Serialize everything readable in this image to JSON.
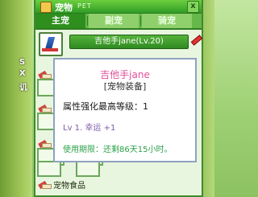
{
  "window": {
    "title": "宠物",
    "title_sub": "PET",
    "close_label": "x"
  },
  "tabs": [
    {
      "label": "主宠"
    },
    {
      "label": "副宠"
    },
    {
      "label": "骑宠"
    }
  ],
  "pet": {
    "name_level": "吉他手jane(Lv.20)"
  },
  "side_labels": [
    "S",
    "X",
    "讥",
    "匙"
  ],
  "bottom_label": "宠物食品",
  "tooltip": {
    "title": "吉他手jane",
    "subtitle": "[宠物装备]",
    "attr_text": "属性强化最高等级：1",
    "bonus_text": "Lv 1. 幸运 +1",
    "expire_text": "使用期限：还剩86天15小时。"
  },
  "colors": {
    "window_border": "#3e8b2c",
    "tooltip_title": "#e0509b",
    "tooltip_bonus": "#7e5aa8",
    "tooltip_expire": "#2ba14a"
  }
}
